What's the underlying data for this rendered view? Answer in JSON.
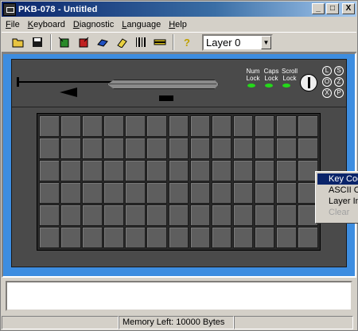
{
  "window": {
    "title": "PKB-078 - Untitled"
  },
  "titlebar_buttons": [
    "_",
    "□",
    "X"
  ],
  "menu": [
    {
      "label": "File",
      "accel": "F",
      "rest": "ile"
    },
    {
      "label": "Keyboard",
      "accel": "K",
      "rest": "eyboard"
    },
    {
      "label": "Diagnostic",
      "accel": "D",
      "rest": "iagnostic"
    },
    {
      "label": "Language",
      "accel": "L",
      "rest": "anguage"
    },
    {
      "label": "Help",
      "accel": "H",
      "rest": "elp"
    }
  ],
  "toolbar": {
    "layer_select_value": "Layer 0"
  },
  "device": {
    "lock_labels": [
      {
        "top": "Num",
        "bottom": "Lock"
      },
      {
        "top": "Caps",
        "bottom": "Lock"
      },
      {
        "top": "Scroll",
        "bottom": "Lock"
      }
    ],
    "mode_letters": [
      "L",
      "S",
      "O",
      "Z",
      "X",
      "P"
    ],
    "keypad_rows": 6,
    "keypad_cols": 13
  },
  "context_menu": {
    "items": [
      {
        "label": "Key Code",
        "state": "selected"
      },
      {
        "label": "ASCII Co",
        "state": "normal"
      },
      {
        "label": "Layer Inc",
        "state": "normal"
      },
      {
        "label": "Clear",
        "state": "disabled"
      }
    ]
  },
  "status": {
    "memory_left": "Memory Left:  10000 Bytes"
  },
  "colors": {
    "workarea_blue": "#3d8de0",
    "device_body": "#4a4a4a",
    "led_green": "#24d81a",
    "title_blue": "#0a246a"
  }
}
